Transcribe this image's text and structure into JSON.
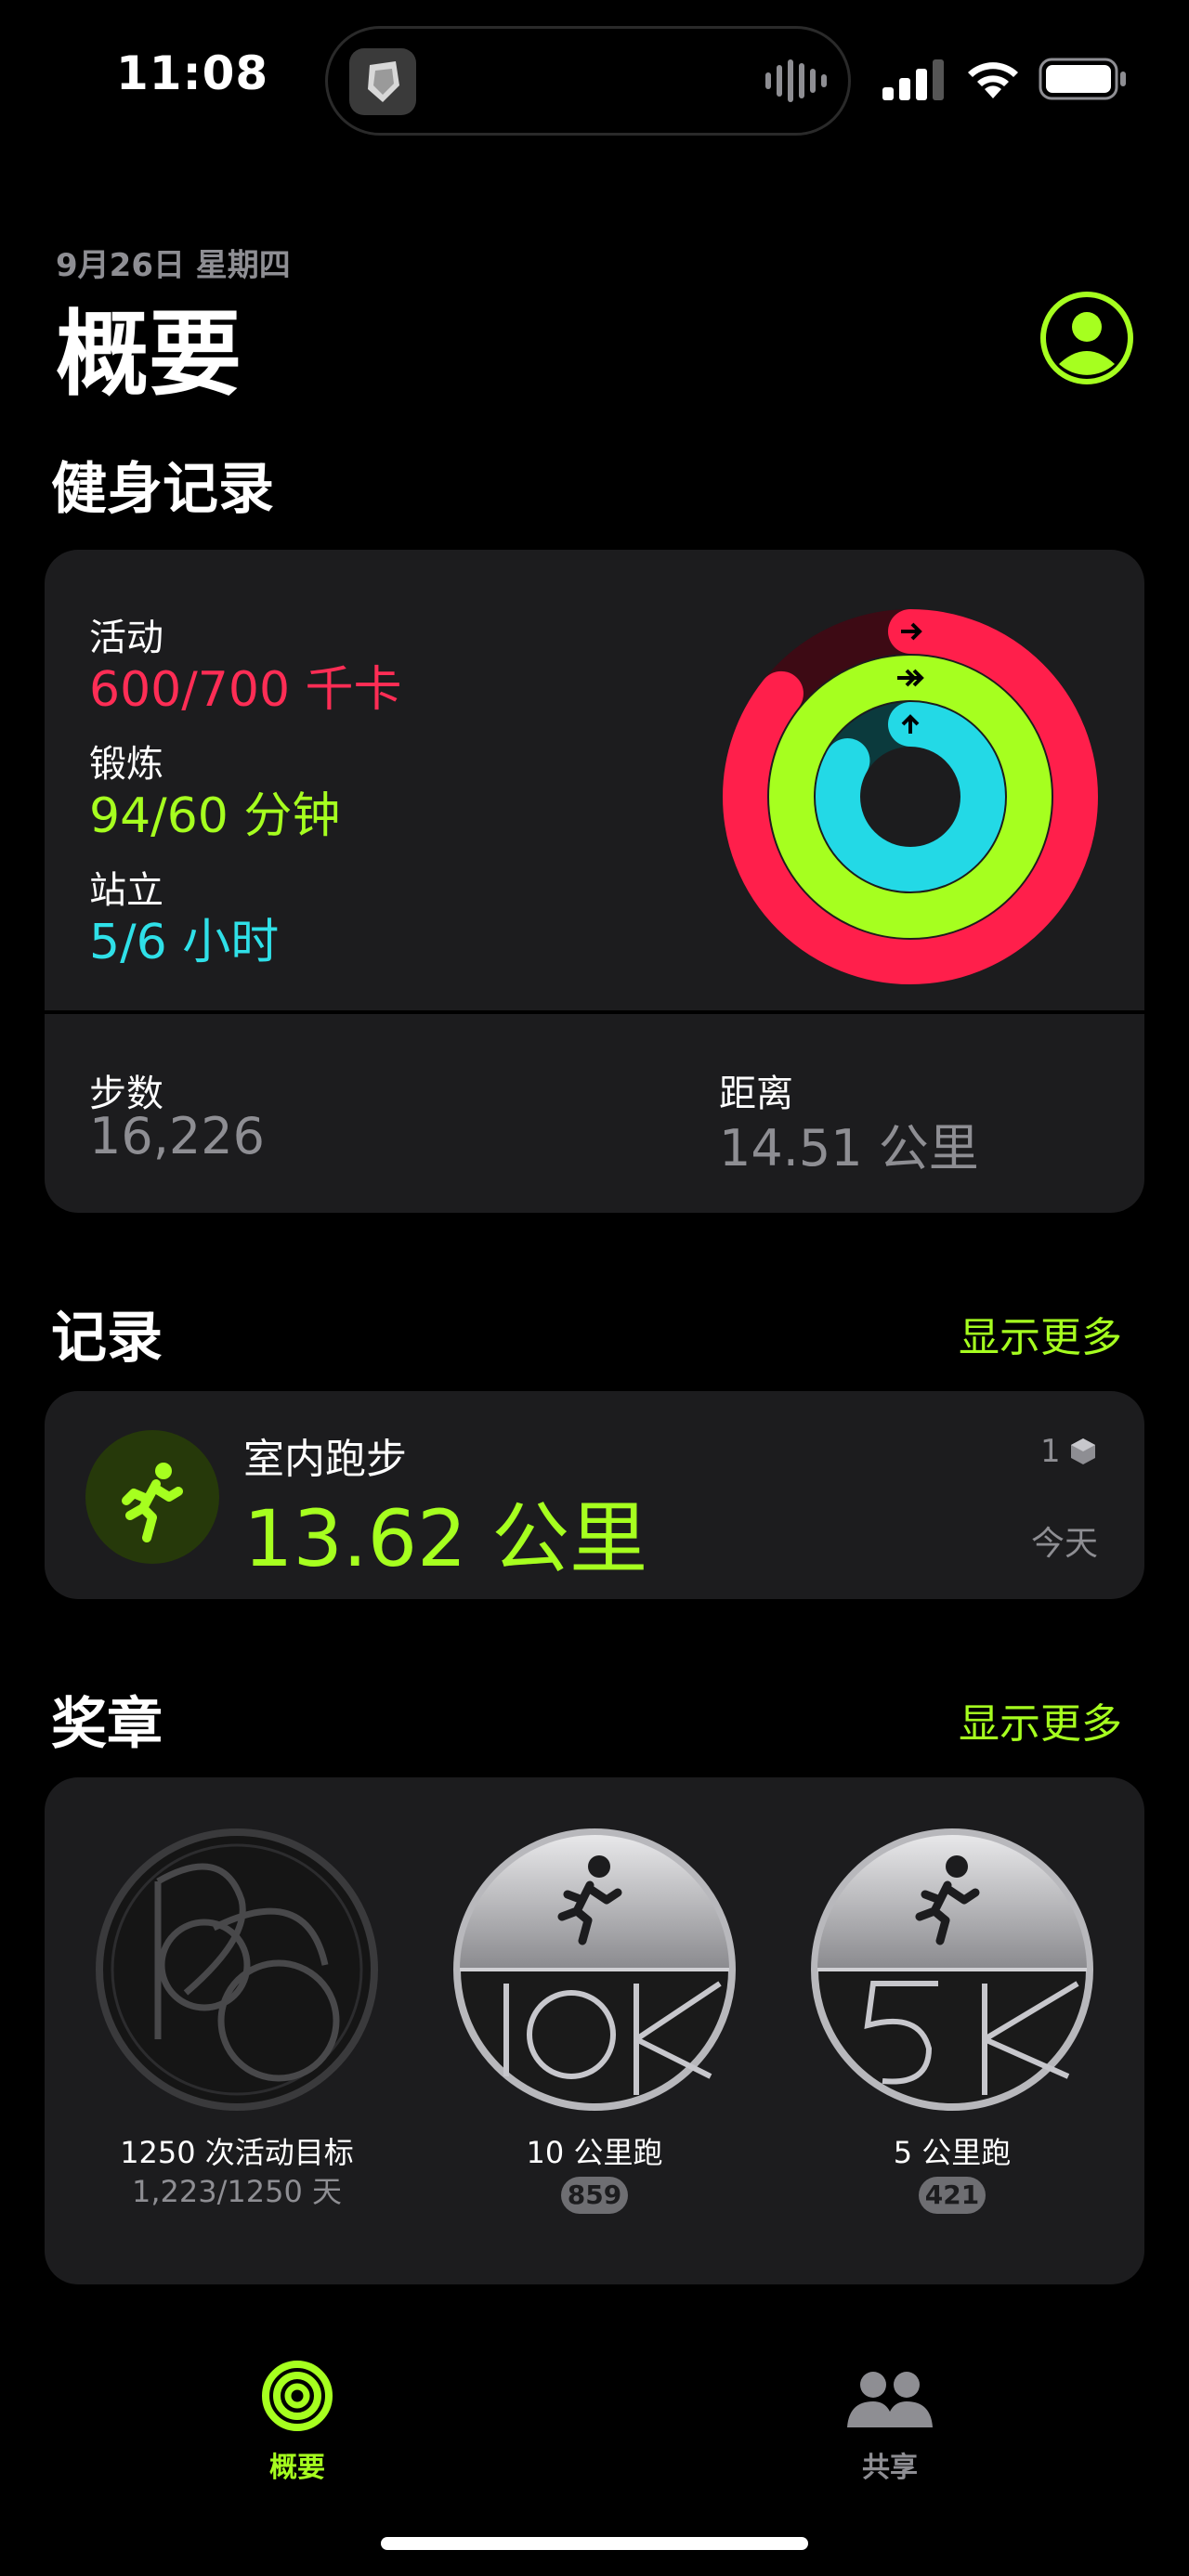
{
  "status_bar": {
    "time": "11:08"
  },
  "header": {
    "date": "9月26日 星期四",
    "title": "概要"
  },
  "fitness": {
    "section_title": "健身记录",
    "move": {
      "label": "活动",
      "value": "600/700 千卡",
      "progress": 0.857,
      "color": "#ff2d55"
    },
    "exercise": {
      "label": "锻炼",
      "value": "94/60 分钟",
      "progress": 1.567,
      "color": "#a6ff1f"
    },
    "stand": {
      "label": "站立",
      "value": "5/6 小时",
      "progress": 0.833,
      "color": "#2fe0e8"
    },
    "steps": {
      "label": "步数",
      "value": "16,226"
    },
    "distance": {
      "label": "距离",
      "value": "14.51 公里"
    }
  },
  "records": {
    "section_title": "记录",
    "show_more": "显示更多",
    "workout": {
      "name": "室内跑步",
      "distance": "13.62 公里",
      "count": "1",
      "when": "今天",
      "icon": "running-figure-icon"
    }
  },
  "awards": {
    "section_title": "奖章",
    "show_more": "显示更多",
    "items": [
      {
        "name": "1250 次活动目标",
        "sub": "1,223/1250 天",
        "icon": "1250-medal-icon"
      },
      {
        "name": "10 公里跑",
        "badge": "859",
        "icon": "10k-medal-icon"
      },
      {
        "name": "5 公里跑",
        "badge": "421",
        "icon": "5k-medal-icon"
      }
    ]
  },
  "tab_bar": {
    "tabs": [
      {
        "label": "概要",
        "icon": "summary-rings-icon",
        "active": true,
        "color": "#a6ff1f"
      },
      {
        "label": "共享",
        "icon": "sharing-people-icon",
        "active": false,
        "color": "#8e8e93"
      }
    ]
  }
}
